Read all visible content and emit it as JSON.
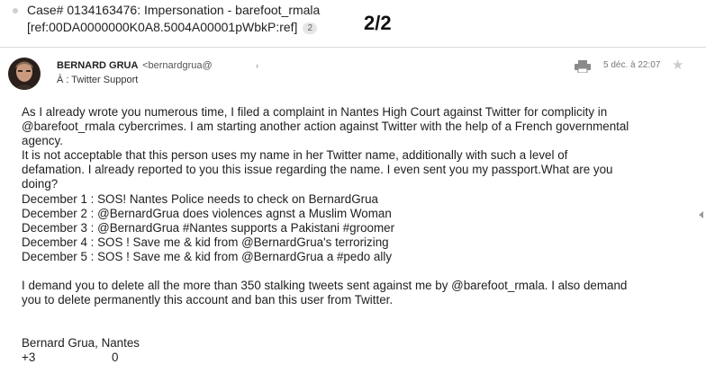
{
  "thread": {
    "subject": "Case# 0134163476: Impersonation - barefoot_rmala",
    "ref": "[ref:00DA0000000K0A8.5004A00001pWbkP:ref]",
    "message_count": "2",
    "page_counter": "2/2"
  },
  "message": {
    "sender_name": "BERNARD GRUA",
    "sender_email": "<bernardgrua@",
    "recipient": "À : Twitter Support",
    "date": "5 déc. à 22:07",
    "body": {
      "para1": [
        "As I already wrote you numerous time, I filed a complaint in Nantes High Court against Twitter for complicity in",
        "@barefoot_rmala cybercrimes. I am starting another action against Twitter with the help of a French governmental",
        "agency.",
        "It is not acceptable that this person uses my name in her Twitter name, additionally with such a level of",
        "defamation. I already reported to you this issue regarding the name. I even sent you my passport.What are you",
        "doing?",
        "December 1 : SOS! Nantes Police needs to check on BernardGrua",
        "December 2 : @BernardGrua does violences agnst a Muslim Woman",
        "December 3 : @BernardGrua #Nantes supports a Pakistani #groomer",
        "December 4 : SOS ! Save me & kid from @BernardGrua's terrorizing",
        "December 5 : SOS ! Save me & kid from @BernardGrua a #pedo ally"
      ],
      "para2": [
        "I demand you to delete all the more than 350 stalking tweets sent against me by @barefoot_rmala. I also demand",
        "you to delete permanently this account and ban this user from Twitter."
      ],
      "signature": "Bernard Grua, Nantes",
      "sig_phone_prefix": "+3",
      "sig_phone_digit": "0"
    }
  },
  "icons": {
    "print": "print-icon",
    "star": "star-icon",
    "caret": "caret-icon",
    "scroll": "scroll-left-arrow-icon"
  },
  "colors": {
    "header_border": "#d9d9d9",
    "star": "#cccccc",
    "muted_text": "#777777"
  }
}
